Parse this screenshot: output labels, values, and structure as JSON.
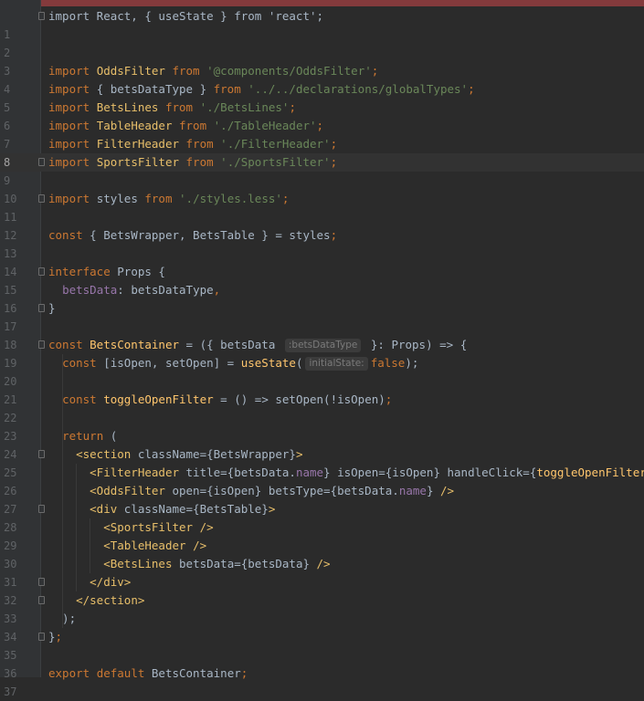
{
  "editor": {
    "current_line": 8,
    "first_line": 0,
    "lines": [
      {
        "n": "",
        "tokens": [
          {
            "t": "import React, { useState } from 'react';",
            "c": "txt"
          }
        ],
        "fold": true
      },
      {
        "n": "1",
        "tokens": []
      },
      {
        "n": "2",
        "tokens": []
      },
      {
        "n": "3",
        "tokens": [
          {
            "t": "import ",
            "c": "kw"
          },
          {
            "t": "OddsFilter ",
            "c": "cls"
          },
          {
            "t": "from ",
            "c": "kw"
          },
          {
            "t": "'@components/OddsFilter'",
            "c": "str"
          },
          {
            "t": ";",
            "c": "kw"
          }
        ]
      },
      {
        "n": "4",
        "tokens": [
          {
            "t": "import ",
            "c": "kw"
          },
          {
            "t": "{ betsDataType } ",
            "c": "txt"
          },
          {
            "t": "from ",
            "c": "kw"
          },
          {
            "t": "'../../declarations/globalTypes'",
            "c": "str"
          },
          {
            "t": ";",
            "c": "kw"
          }
        ]
      },
      {
        "n": "5",
        "tokens": [
          {
            "t": "import ",
            "c": "kw"
          },
          {
            "t": "BetsLines ",
            "c": "cls"
          },
          {
            "t": "from ",
            "c": "kw"
          },
          {
            "t": "'./BetsLines'",
            "c": "str"
          },
          {
            "t": ";",
            "c": "kw"
          }
        ]
      },
      {
        "n": "6",
        "tokens": [
          {
            "t": "import ",
            "c": "kw"
          },
          {
            "t": "TableHeader ",
            "c": "cls"
          },
          {
            "t": "from ",
            "c": "kw"
          },
          {
            "t": "'./TableHeader'",
            "c": "str"
          },
          {
            "t": ";",
            "c": "kw"
          }
        ]
      },
      {
        "n": "7",
        "tokens": [
          {
            "t": "import ",
            "c": "kw"
          },
          {
            "t": "FilterHeader ",
            "c": "cls"
          },
          {
            "t": "from ",
            "c": "kw"
          },
          {
            "t": "'./FilterHeader'",
            "c": "str"
          },
          {
            "t": ";",
            "c": "kw"
          }
        ]
      },
      {
        "n": "8",
        "tokens": [
          {
            "t": "import ",
            "c": "kw"
          },
          {
            "t": "SportsFilter ",
            "c": "cls"
          },
          {
            "t": "from ",
            "c": "kw"
          },
          {
            "t": "'./SportsFilter'",
            "c": "str"
          },
          {
            "t": ";",
            "c": "kw"
          }
        ],
        "fold": true
      },
      {
        "n": "9",
        "tokens": []
      },
      {
        "n": "10",
        "tokens": [
          {
            "t": "import ",
            "c": "kw"
          },
          {
            "t": "styles ",
            "c": "txt"
          },
          {
            "t": "from ",
            "c": "kw"
          },
          {
            "t": "'./styles.less'",
            "c": "str"
          },
          {
            "t": ";",
            "c": "kw"
          }
        ],
        "fold": true
      },
      {
        "n": "11",
        "tokens": []
      },
      {
        "n": "12",
        "tokens": [
          {
            "t": "const ",
            "c": "kw"
          },
          {
            "t": "{ BetsWrapper, BetsTable } = styles",
            "c": "txt"
          },
          {
            "t": ";",
            "c": "kw"
          }
        ]
      },
      {
        "n": "13",
        "tokens": []
      },
      {
        "n": "14",
        "tokens": [
          {
            "t": "interface ",
            "c": "kw"
          },
          {
            "t": "Props {",
            "c": "txt"
          }
        ],
        "fold": true
      },
      {
        "n": "15",
        "tokens": [
          {
            "t": "  ",
            "c": "txt"
          },
          {
            "t": "betsData",
            "c": "prop"
          },
          {
            "t": ": betsDataType",
            "c": "txt"
          },
          {
            "t": ",",
            "c": "kw"
          }
        ]
      },
      {
        "n": "16",
        "tokens": [
          {
            "t": "}",
            "c": "txt"
          }
        ],
        "fold": true
      },
      {
        "n": "17",
        "tokens": []
      },
      {
        "n": "18",
        "tokens": [
          {
            "t": "const ",
            "c": "kw"
          },
          {
            "t": "BetsContainer",
            "c": "fn"
          },
          {
            "t": " = ({ betsData ",
            "c": "txt"
          },
          {
            "hint": ":betsDataType"
          },
          {
            "t": " }: Props) => {",
            "c": "txt"
          }
        ],
        "fold": true
      },
      {
        "n": "19",
        "tokens": [
          {
            "t": "  ",
            "c": "txt"
          },
          {
            "t": "const ",
            "c": "kw"
          },
          {
            "t": "[isOpen, setOpen] = ",
            "c": "txt"
          },
          {
            "t": "useState",
            "c": "fn"
          },
          {
            "t": "(",
            "c": "txt"
          },
          {
            "hint": "initialState:"
          },
          {
            "t": "false",
            "c": "kw"
          },
          {
            "t": ");",
            "c": "txt"
          }
        ]
      },
      {
        "n": "20",
        "tokens": []
      },
      {
        "n": "21",
        "tokens": [
          {
            "t": "  ",
            "c": "txt"
          },
          {
            "t": "const ",
            "c": "kw"
          },
          {
            "t": "toggleOpenFilter",
            "c": "fn"
          },
          {
            "t": " = () => setOpen(!isOpen)",
            "c": "txt"
          },
          {
            "t": ";",
            "c": "kw"
          }
        ]
      },
      {
        "n": "22",
        "tokens": []
      },
      {
        "n": "23",
        "tokens": [
          {
            "t": "  ",
            "c": "txt"
          },
          {
            "t": "return ",
            "c": "kw"
          },
          {
            "t": "(",
            "c": "txt"
          }
        ]
      },
      {
        "n": "24",
        "tokens": [
          {
            "t": "    ",
            "c": "txt"
          },
          {
            "t": "<section ",
            "c": "cls"
          },
          {
            "t": "className={BetsWrapper}",
            "c": "txt"
          },
          {
            "t": ">",
            "c": "cls"
          }
        ],
        "fold": true
      },
      {
        "n": "25",
        "tokens": [
          {
            "t": "      ",
            "c": "txt"
          },
          {
            "t": "<FilterHeader ",
            "c": "cls"
          },
          {
            "t": "title={betsData.",
            "c": "txt"
          },
          {
            "t": "name",
            "c": "prop"
          },
          {
            "t": "} isOpen={isOpen} handleClick={",
            "c": "txt"
          },
          {
            "t": "toggleOpenFilter",
            "c": "fn"
          },
          {
            "t": "} ",
            "c": "txt"
          },
          {
            "t": "/>",
            "c": "cls"
          }
        ]
      },
      {
        "n": "26",
        "tokens": [
          {
            "t": "      ",
            "c": "txt"
          },
          {
            "t": "<OddsFilter ",
            "c": "cls"
          },
          {
            "t": "open={isOpen} betsType={betsData.",
            "c": "txt"
          },
          {
            "t": "name",
            "c": "prop"
          },
          {
            "t": "} ",
            "c": "txt"
          },
          {
            "t": "/>",
            "c": "cls"
          }
        ]
      },
      {
        "n": "27",
        "tokens": [
          {
            "t": "      ",
            "c": "txt"
          },
          {
            "t": "<div ",
            "c": "cls"
          },
          {
            "t": "className={BetsTable}",
            "c": "txt"
          },
          {
            "t": ">",
            "c": "cls"
          }
        ],
        "fold": true
      },
      {
        "n": "28",
        "tokens": [
          {
            "t": "        ",
            "c": "txt"
          },
          {
            "t": "<SportsFilter ",
            "c": "cls"
          },
          {
            "t": "/>",
            "c": "cls"
          }
        ]
      },
      {
        "n": "29",
        "tokens": [
          {
            "t": "        ",
            "c": "txt"
          },
          {
            "t": "<TableHeader ",
            "c": "cls"
          },
          {
            "t": "/>",
            "c": "cls"
          }
        ]
      },
      {
        "n": "30",
        "tokens": [
          {
            "t": "        ",
            "c": "txt"
          },
          {
            "t": "<BetsLines ",
            "c": "cls"
          },
          {
            "t": "betsData={betsData} ",
            "c": "txt"
          },
          {
            "t": "/>",
            "c": "cls"
          }
        ]
      },
      {
        "n": "31",
        "tokens": [
          {
            "t": "      ",
            "c": "txt"
          },
          {
            "t": "</div>",
            "c": "cls"
          }
        ],
        "fold": true
      },
      {
        "n": "32",
        "tokens": [
          {
            "t": "    ",
            "c": "txt"
          },
          {
            "t": "</section>",
            "c": "cls"
          }
        ],
        "fold": true
      },
      {
        "n": "33",
        "tokens": [
          {
            "t": "  );",
            "c": "txt"
          }
        ]
      },
      {
        "n": "34",
        "tokens": [
          {
            "t": "}",
            "c": "txt"
          },
          {
            "t": ";",
            "c": "kw"
          }
        ],
        "fold": true
      },
      {
        "n": "35",
        "tokens": []
      },
      {
        "n": "36",
        "tokens": [
          {
            "t": "export ",
            "c": "kw"
          },
          {
            "t": "default ",
            "c": "kw"
          },
          {
            "t": "BetsContainer",
            "c": "txt"
          },
          {
            "t": ";",
            "c": "kw"
          }
        ]
      },
      {
        "n": "37",
        "tokens": []
      }
    ]
  },
  "colors": {
    "background": "#2b2b2b",
    "keyword": "#cc7832",
    "string": "#6a8759",
    "tag": "#e8bf6a",
    "function": "#ffc66d",
    "property": "#9876aa",
    "text": "#a9b7c6"
  }
}
